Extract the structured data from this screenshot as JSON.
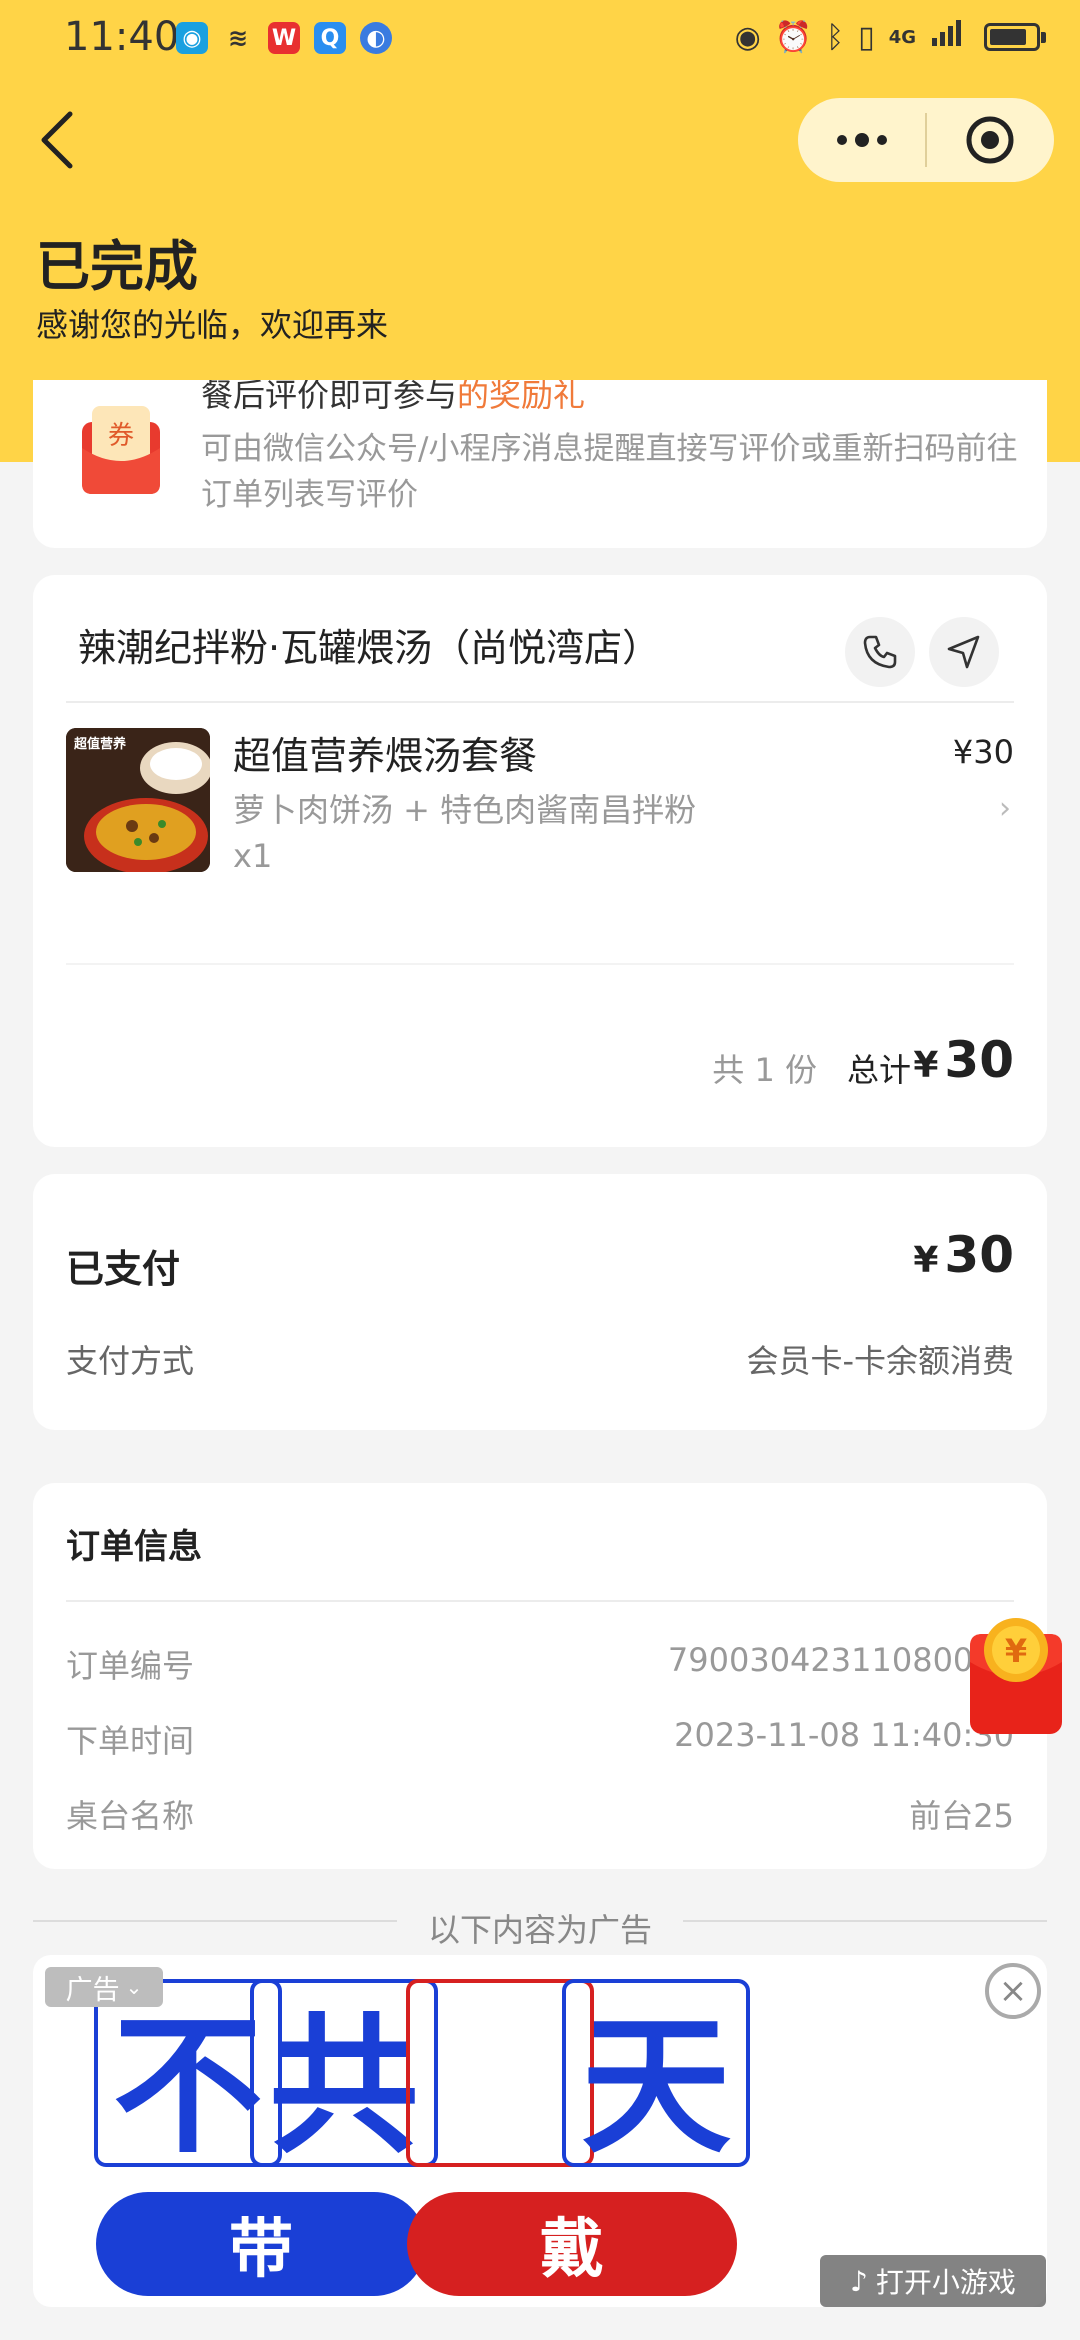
{
  "status_bar": {
    "time": "11:40",
    "left_icons": [
      "app-icon-teal",
      "wifi-signal-icon",
      "wps-icon",
      "search-app-icon",
      "browser-icon"
    ],
    "net_label": "4G"
  },
  "header": {
    "status_title": "已完成",
    "status_subtitle": "感谢您的光临，欢迎再来",
    "bg_color": "#ffd447"
  },
  "review": {
    "cut_text_a": "餐后评价即可参与",
    "cut_text_b": "的奖励礼",
    "text": "可由微信公众号/小程序消息提醒直接写评价或重新扫码前往订单列表写评价",
    "icon_label": "券"
  },
  "shop": {
    "name": "辣潮纪拌粉·瓦罐煨汤（尚悦湾店）",
    "item": {
      "name": "超值营养煨汤套餐",
      "desc": "萝卜肉饼汤 + 特色肉酱南昌拌粉",
      "qty": "x1",
      "price": "¥30",
      "img_text": "超值营养"
    },
    "count": "共 1 份",
    "total_label": "总计",
    "total_currency": "¥",
    "total_value": "30"
  },
  "payment": {
    "label": "已支付",
    "currency": "¥",
    "amount": "30",
    "method_label": "支付方式",
    "method_value": "会员卡-卡余额消费"
  },
  "order": {
    "title": "订单信息",
    "rows": [
      {
        "label": "订单编号",
        "value": "79003042311080050"
      },
      {
        "label": "下单时间",
        "value": "2023-11-08 11:40:30"
      },
      {
        "label": "桌台名称",
        "value": "前台25"
      }
    ]
  },
  "ad": {
    "divider": "以下内容为广告",
    "tag": "广告",
    "chars": [
      "不",
      "共",
      "",
      "天"
    ],
    "btn_left": "带",
    "btn_right": "戴",
    "open_game": "打开小游戏",
    "blue": "#1a3fd6",
    "red": "#d62020"
  },
  "float": {
    "icon": "¥"
  }
}
